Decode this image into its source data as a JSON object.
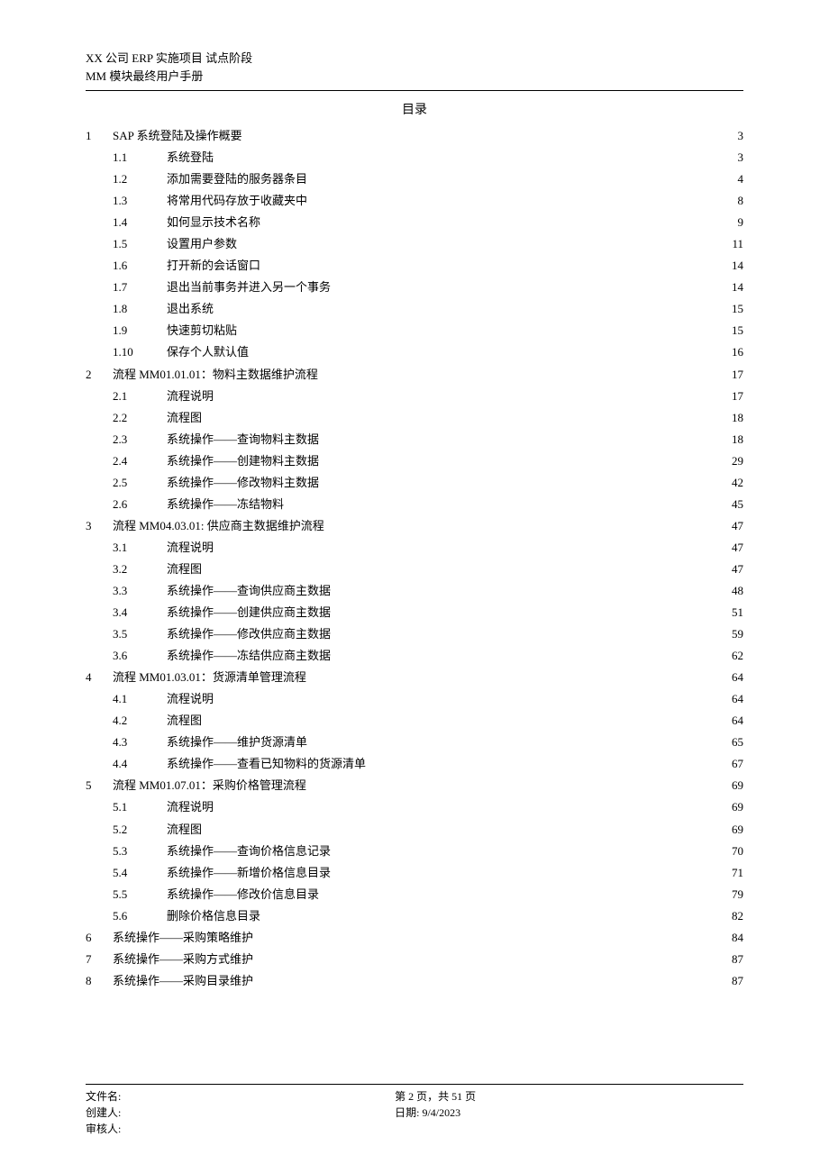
{
  "header": {
    "line1": "XX 公司 ERP 实施项目 试点阶段",
    "line2": "MM 模块最终用户手册"
  },
  "toc_title": "目录",
  "toc": [
    {
      "level": 1,
      "num": "1",
      "text": "SAP 系统登陆及操作概要",
      "page": "3"
    },
    {
      "level": 2,
      "num": "1.1",
      "text": "系统登陆",
      "page": "3"
    },
    {
      "level": 2,
      "num": "1.2",
      "text": "添加需要登陆的服务器条目",
      "page": "4"
    },
    {
      "level": 2,
      "num": "1.3",
      "text": "将常用代码存放于收藏夹中",
      "page": "8"
    },
    {
      "level": 2,
      "num": "1.4",
      "text": "如何显示技术名称",
      "page": "9"
    },
    {
      "level": 2,
      "num": "1.5",
      "text": "设置用户参数",
      "page": "11"
    },
    {
      "level": 2,
      "num": "1.6",
      "text": "打开新的会话窗口",
      "page": "14"
    },
    {
      "level": 2,
      "num": "1.7",
      "text": "退出当前事务并进入另一个事务",
      "page": "14"
    },
    {
      "level": 2,
      "num": "1.8",
      "text": "退出系统",
      "page": "15"
    },
    {
      "level": 2,
      "num": "1.9",
      "text": "快速剪切粘贴",
      "page": "15"
    },
    {
      "level": 2,
      "num": "1.10",
      "text": "保存个人默认值",
      "page": "16"
    },
    {
      "level": 1,
      "num": "2",
      "text": "流程 MM01.01.01：物料主数据维护流程",
      "page": "17"
    },
    {
      "level": 2,
      "num": "2.1",
      "text": "流程说明",
      "page": "17"
    },
    {
      "level": 2,
      "num": "2.2",
      "text": "流程图",
      "page": "18"
    },
    {
      "level": 2,
      "num": "2.3",
      "text": "系统操作——查询物料主数据",
      "page": "18"
    },
    {
      "level": 2,
      "num": "2.4",
      "text": "系统操作——创建物料主数据",
      "page": "29"
    },
    {
      "level": 2,
      "num": "2.5",
      "text": "系统操作——修改物料主数据",
      "page": "42"
    },
    {
      "level": 2,
      "num": "2.6",
      "text": "系统操作——冻结物料",
      "page": "45"
    },
    {
      "level": 1,
      "num": "3",
      "text": "流程 MM04.03.01: 供应商主数据维护流程",
      "page": "47"
    },
    {
      "level": 2,
      "num": "3.1",
      "text": "流程说明",
      "page": "47"
    },
    {
      "level": 2,
      "num": "3.2",
      "text": "流程图",
      "page": "47"
    },
    {
      "level": 2,
      "num": "3.3",
      "text": "系统操作——查询供应商主数据",
      "page": "48"
    },
    {
      "level": 2,
      "num": "3.4",
      "text": "系统操作——创建供应商主数据",
      "page": "51"
    },
    {
      "level": 2,
      "num": "3.5",
      "text": "系统操作——修改供应商主数据",
      "page": "59"
    },
    {
      "level": 2,
      "num": "3.6",
      "text": "系统操作——冻结供应商主数据",
      "page": "62"
    },
    {
      "level": 1,
      "num": "4",
      "text": "流程 MM01.03.01：货源清单管理流程",
      "page": "64"
    },
    {
      "level": 2,
      "num": "4.1",
      "text": "流程说明",
      "page": "64"
    },
    {
      "level": 2,
      "num": "4.2",
      "text": "流程图",
      "page": "64"
    },
    {
      "level": 2,
      "num": "4.3",
      "text": "系统操作——维护货源清单",
      "page": "65"
    },
    {
      "level": 2,
      "num": "4.4",
      "text": "系统操作——查看已知物料的货源清单",
      "page": "67"
    },
    {
      "level": 1,
      "num": "5",
      "text": "流程 MM01.07.01：采购价格管理流程",
      "page": "69"
    },
    {
      "level": 2,
      "num": "5.1",
      "text": "流程说明",
      "page": "69"
    },
    {
      "level": 2,
      "num": "5.2",
      "text": "流程图",
      "page": "69"
    },
    {
      "level": 2,
      "num": "5.3",
      "text": "系统操作——查询价格信息记录",
      "page": "70"
    },
    {
      "level": 2,
      "num": "5.4",
      "text": "系统操作——新增价格信息目录",
      "page": "71"
    },
    {
      "level": 2,
      "num": "5.5",
      "text": "系统操作——修改价信息目录",
      "page": "79"
    },
    {
      "level": 2,
      "num": "5.6",
      "text": "删除价格信息目录",
      "page": "82"
    },
    {
      "level": 1,
      "num": "6",
      "text": "系统操作——采购策略维护",
      "page": "84"
    },
    {
      "level": 1,
      "num": "7",
      "text": "系统操作——采购方式维护",
      "page": "87"
    },
    {
      "level": 1,
      "num": "8",
      "text": "系统操作——采购目录维护",
      "page": "87"
    }
  ],
  "footer": {
    "left": {
      "filename_label": "文件名:",
      "creator_label": "创建人:",
      "reviewer_label": "审核人:"
    },
    "right": {
      "page_info": "第 2 页，共 51 页",
      "date_label": "日期: ",
      "date_value": "9/4/2023"
    }
  }
}
